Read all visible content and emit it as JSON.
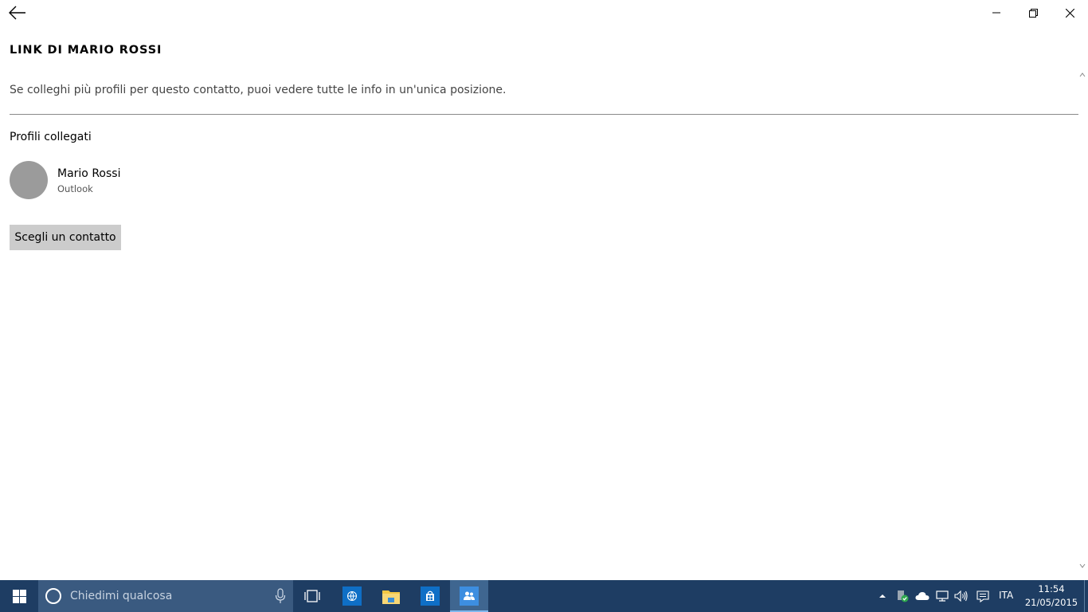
{
  "window": {
    "title": "LINK DI MARIO ROSSI",
    "description": "Se colleghi più profili per questo contatto, puoi vedere tutte le info in un'unica posizione."
  },
  "section": {
    "title": "Profili collegati"
  },
  "profiles": [
    {
      "name": "Mario Rossi",
      "source": "Outlook"
    }
  ],
  "actions": {
    "choose_contact": "Scegli un contatto"
  },
  "taskbar": {
    "search_placeholder": "Chiedimi qualcosa",
    "language": "ITA",
    "time": "11:54",
    "date": "21/05/2015",
    "active_app": "people-icon"
  },
  "colors": {
    "taskbar": "#1e3d63",
    "search_box": "#3a5a80",
    "active_app": "#3f6690",
    "avatar": "#9b9b9b",
    "button": "#cccccc"
  }
}
